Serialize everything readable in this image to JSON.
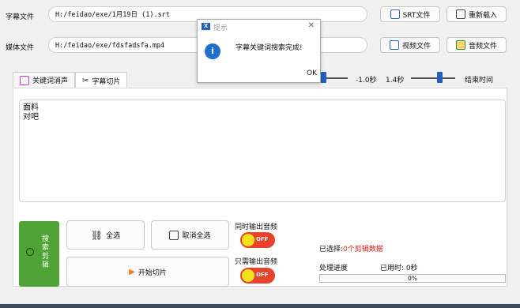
{
  "srt": {
    "label": "字幕文件",
    "value": "H:/feidao/exe/1月19日 (1).srt",
    "button": "SRT文件",
    "reload": "重新载入"
  },
  "media": {
    "label": "媒体文件",
    "value": "H:/feidao/exe/fdsfadsfa.mp4",
    "video_button": "视频文件",
    "audio_button": "音频文件"
  },
  "timing": {
    "start_offset": "-1.0秒",
    "end_offset": "1.4秒",
    "end_label": "结束时间"
  },
  "tabs": [
    {
      "label": "关键词消声"
    },
    {
      "label": "字幕切片"
    }
  ],
  "keywords_text": "面料\n对吧",
  "actions": {
    "search": "搜索剪辑",
    "select_all": "全选",
    "deselect_all": "取消全选",
    "start": "开始切片"
  },
  "options": {
    "both_audio": "同时输出音频",
    "only_audio": "只需输出音频",
    "toggle_state": "OFF"
  },
  "status": {
    "selected_prefix": "已选择:",
    "selected_value": "0个剪辑数据",
    "progress_label": "处理进度",
    "elapsed": "已用时: 0秒",
    "progress_percent": "0%"
  },
  "dialog": {
    "title": "提示",
    "message": "字幕关键词搜索完成!",
    "ok": "OK"
  },
  "colors": {
    "search_green": "#4ea334",
    "accent_blue": "#1f5fbf",
    "toggle_red": "#e8412c",
    "selected_red": "#e02020"
  }
}
